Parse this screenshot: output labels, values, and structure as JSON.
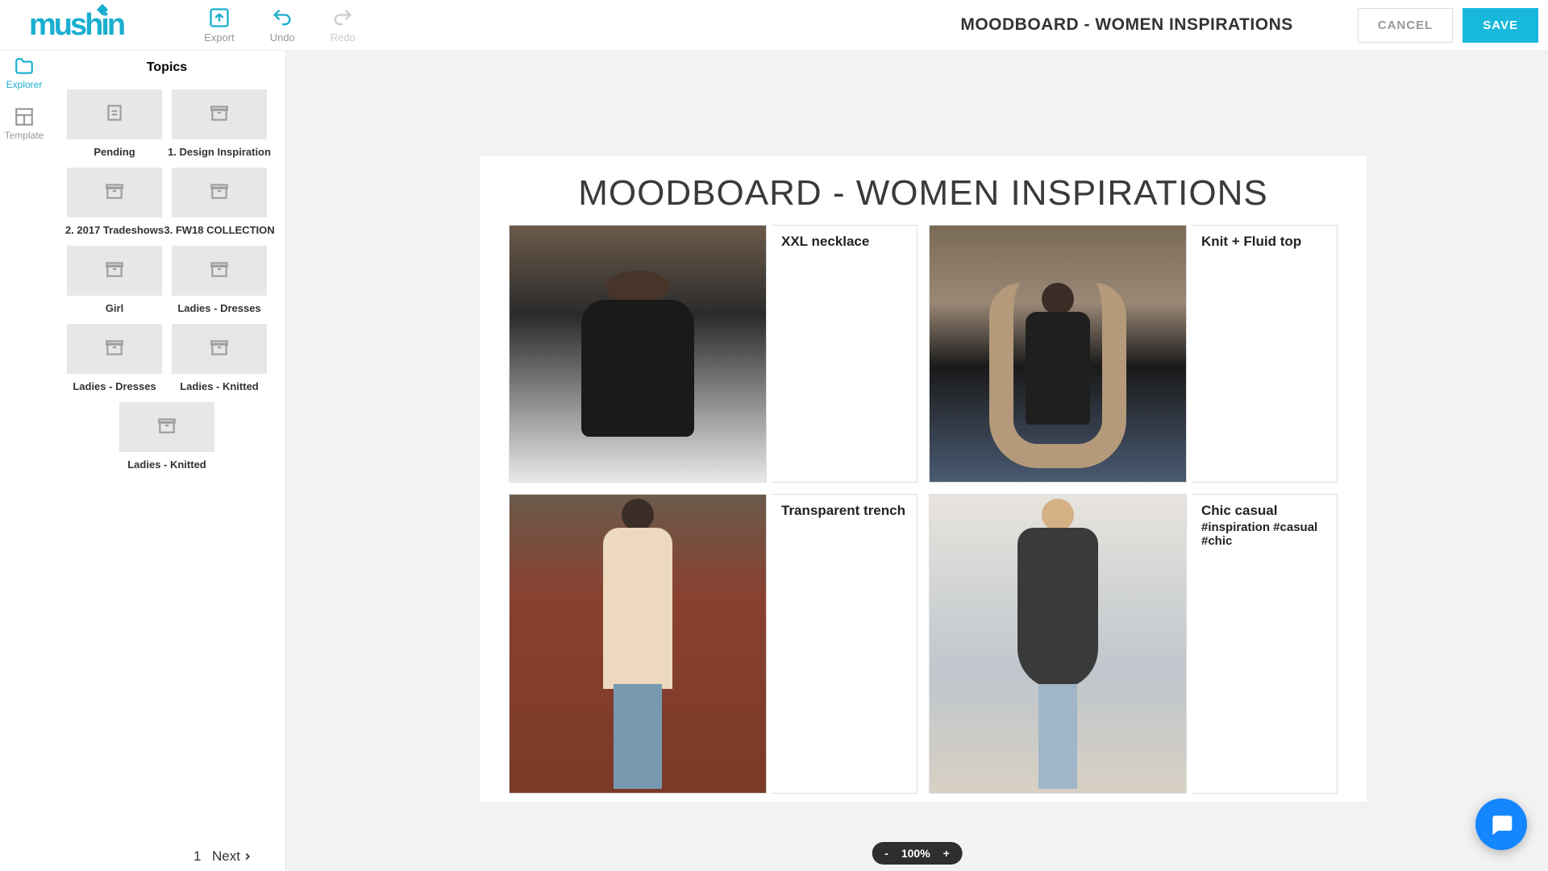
{
  "logo_text": "mushin",
  "toolbar": {
    "export": "Export",
    "undo": "Undo",
    "redo": "Redo"
  },
  "header": {
    "title": "MOODBOARD - WOMEN INSPIRATIONS",
    "cancel": "CANCEL",
    "save": "SAVE"
  },
  "rail": {
    "explorer": "Explorer",
    "template": "Template"
  },
  "sidebar": {
    "title": "Topics",
    "topics": [
      {
        "label": "Pending",
        "icon": "document"
      },
      {
        "label": "1. Design Inspiration",
        "icon": "box"
      },
      {
        "label": "2. 2017 Tradeshows",
        "icon": "box"
      },
      {
        "label": "3. FW18 COLLECTION",
        "icon": "box"
      },
      {
        "label": "Girl",
        "icon": "box"
      },
      {
        "label": "Ladies - Dresses",
        "icon": "box"
      },
      {
        "label": "Ladies - Dresses",
        "icon": "box"
      },
      {
        "label": "Ladies - Knitted",
        "icon": "box"
      },
      {
        "label": "Ladies - Knitted",
        "icon": "box"
      }
    ],
    "page_current": "1",
    "next": "Next"
  },
  "board": {
    "title": "MOODBOARD - WOMEN INSPIRATIONS",
    "cards": [
      {
        "title": "XXL necklace",
        "tags": ""
      },
      {
        "title": "Knit + Fluid top",
        "tags": ""
      },
      {
        "title": "Transparent trench",
        "tags": ""
      },
      {
        "title": "Chic casual",
        "tags": "#inspiration #casual #chic"
      }
    ]
  },
  "zoom": {
    "minus": "-",
    "value": "100%",
    "plus": "+"
  }
}
